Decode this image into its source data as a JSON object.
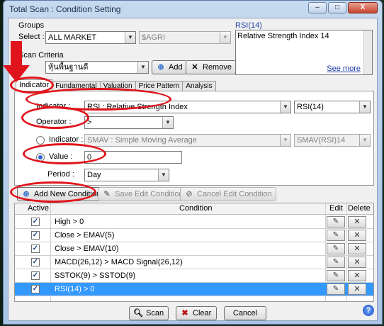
{
  "window": {
    "title": "Total Scan : Condition Setting",
    "minimize_label": "–",
    "maximize_label": "□",
    "close_label": "X"
  },
  "groups": {
    "label": "Groups",
    "select_label": "Select :",
    "market_value": "ALL MARKET",
    "sector_value": "$AGRI"
  },
  "criteria": {
    "label": "Scan Criteria",
    "value": "หุ้นพื้นฐานดี",
    "add_label": "Add",
    "remove_label": "Remove"
  },
  "info_box": {
    "title": "RSI(14)",
    "description": "Relative Strength Index 14",
    "see_more": "See more"
  },
  "tabs": [
    "Indicator",
    "Fundamental",
    "Valuation",
    "Price Pattern",
    "Analysis"
  ],
  "form": {
    "indicator_label": "Indicator :",
    "indicator_value": "RSI : Relative Strength Index",
    "indicator_param": "RSI(14)",
    "operator_label": "Operator :",
    "operator_value": ">",
    "indicator2_label": "Indicator :",
    "indicator2_value": "SMAV : Simple Moving Average",
    "indicator2_param": "SMAV(RSI)14",
    "value_label": "Value :",
    "value_value": "0",
    "period_label": "Period :",
    "period_value": "Day"
  },
  "actions": {
    "add_new": "Add New Condition",
    "save_edit": "Save Edit Condition",
    "cancel_edit": "Cancel Edit Condition"
  },
  "grid": {
    "headers": {
      "active": "Active",
      "condition": "Condition",
      "edit": "Edit",
      "delete": "Delete"
    },
    "rows": [
      {
        "active": true,
        "condition": "High > 0"
      },
      {
        "active": true,
        "condition": "Close > EMAV(5)"
      },
      {
        "active": true,
        "condition": "Close > EMAV(10)"
      },
      {
        "active": true,
        "condition": "MACD(26,12) > MACD Signal(26,12)"
      },
      {
        "active": true,
        "condition": "SSTOK(9) > SSTOD(9)"
      },
      {
        "active": true,
        "condition": "RSI(14) > 0"
      }
    ]
  },
  "footer": {
    "scan": "Scan",
    "clear": "Clear",
    "cancel": "Cancel",
    "help": "?"
  },
  "colors": {
    "annotation": "#e0141c",
    "selection": "#3399ff"
  }
}
